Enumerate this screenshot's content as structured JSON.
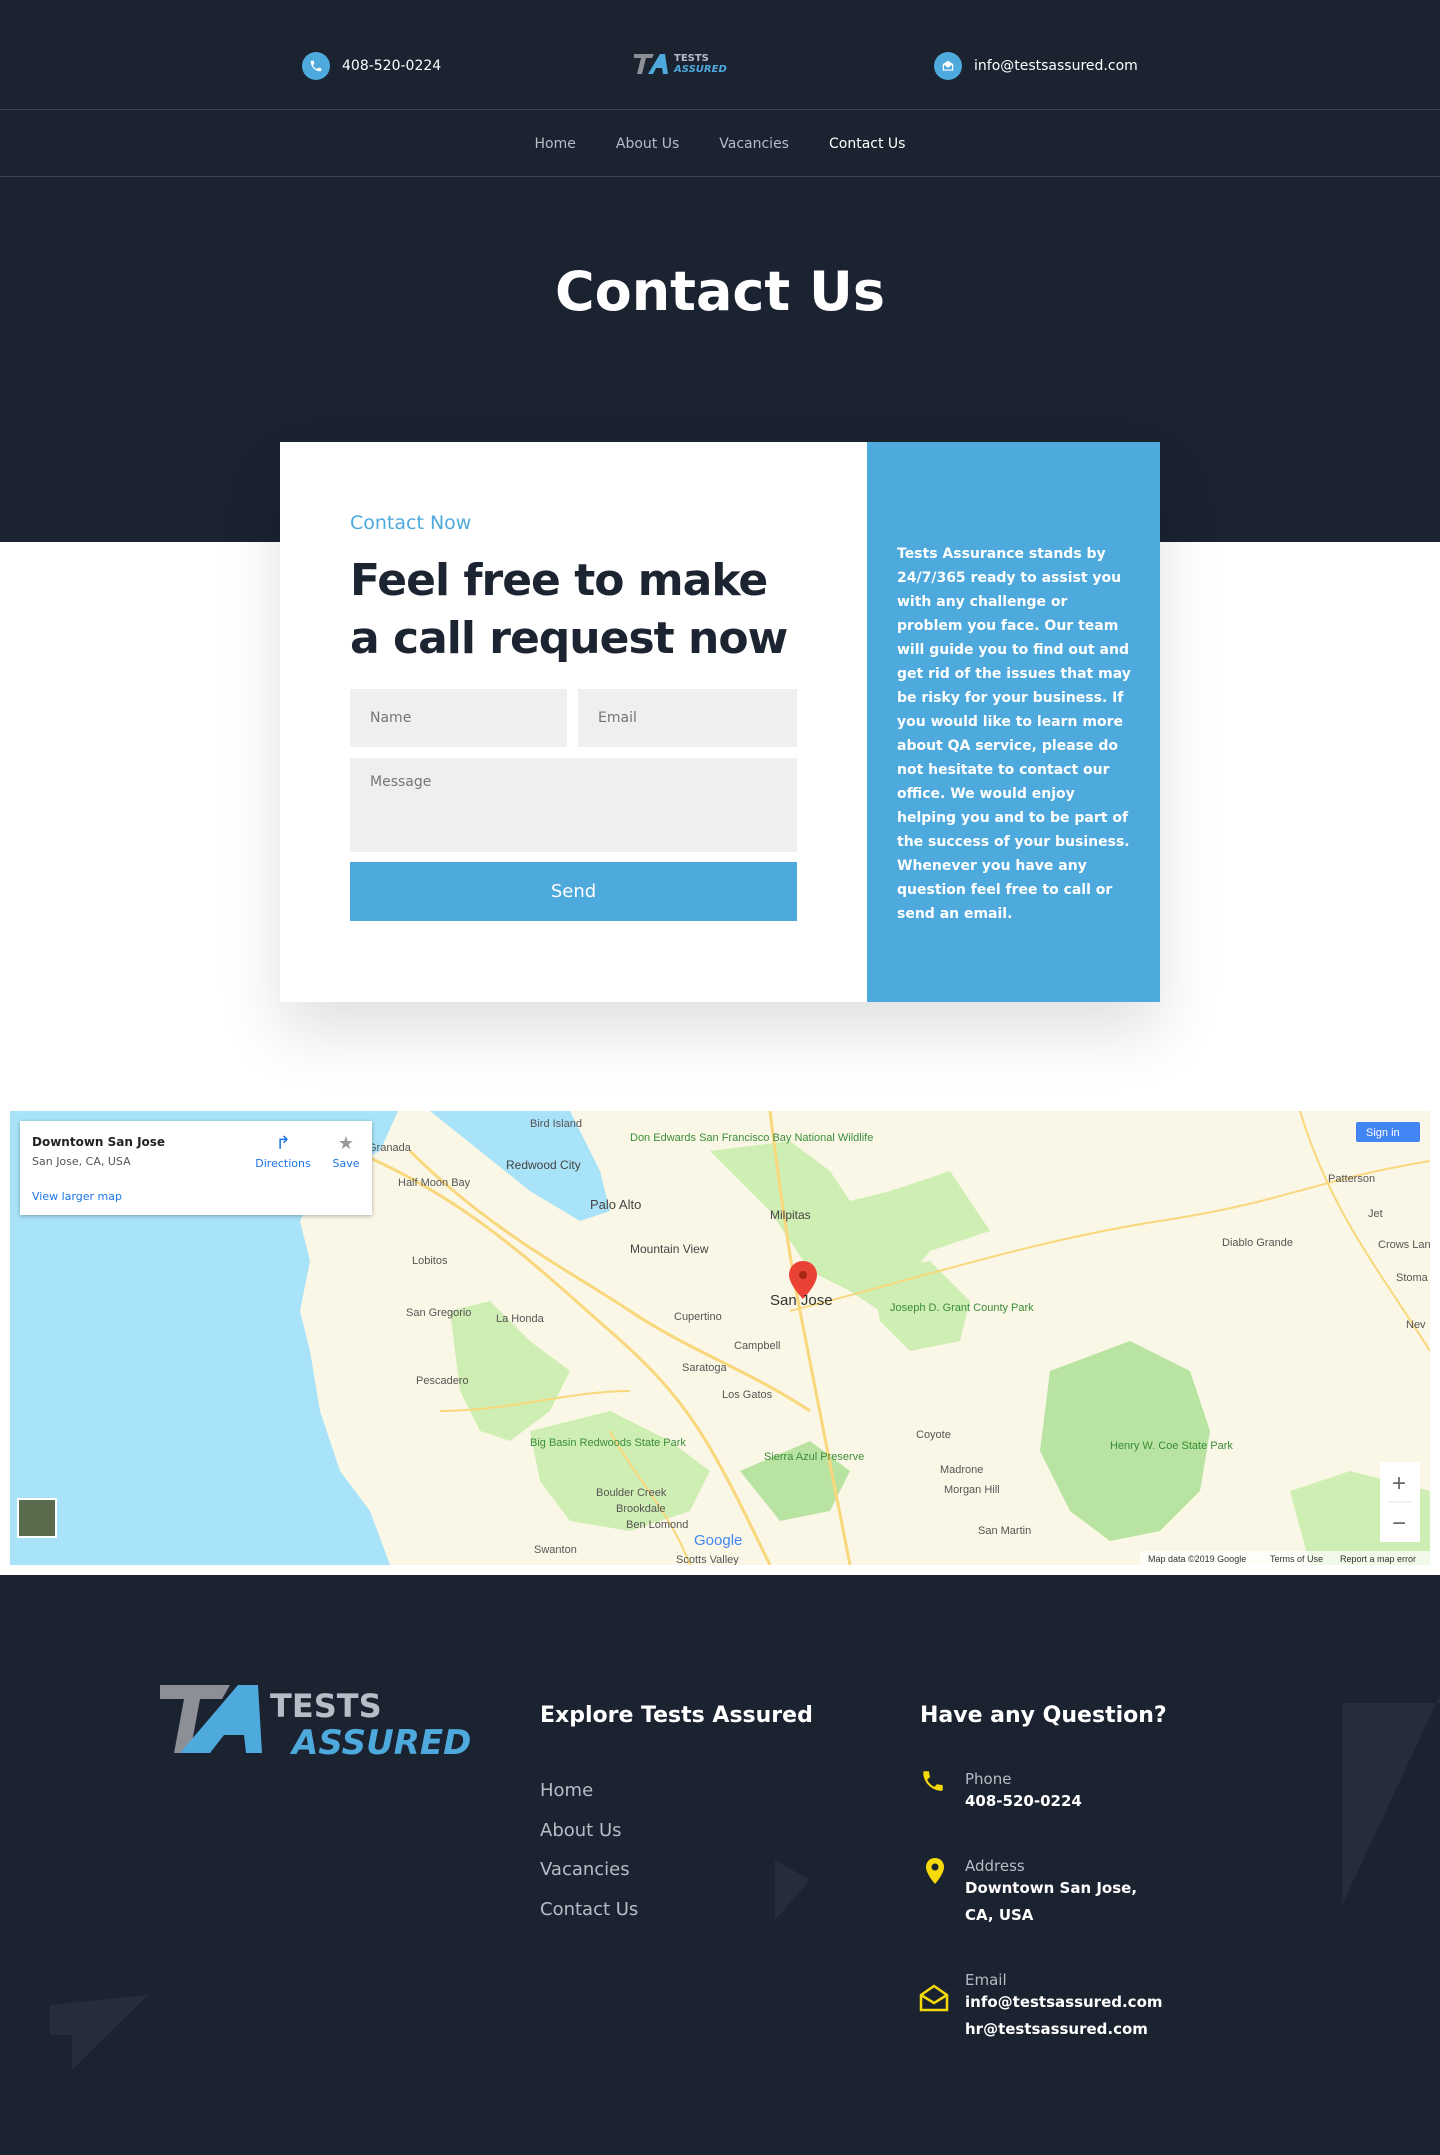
{
  "header": {
    "phone": "408-520-0224",
    "email": "info@testsassured.com",
    "logo_top": "TESTS",
    "logo_bottom": "ASSURED",
    "logo_mark": "TA"
  },
  "nav": {
    "items": [
      "Home",
      "About Us",
      "Vacancies",
      "Contact Us"
    ],
    "active": "Contact Us"
  },
  "page": {
    "title": "Contact Us"
  },
  "contact_card": {
    "kicker": "Contact Now",
    "heading": "Feel free to make a call request now",
    "name_placeholder": "Name",
    "email_placeholder": "Email",
    "message_placeholder": "Message",
    "send_label": "Send",
    "side_text": "Tests Assurance stands by 24/7/365 ready to assist you with any challenge or problem you face. Our team will guide you to find out and get rid of the issues that may be risky for your business. If you would like to learn more about QA service, please do not hesitate to contact our office. We would enjoy helping you and to be part of the success of your business. Whenever you have any question feel free to call or send an email."
  },
  "map": {
    "place_title": "Downtown San Jose",
    "place_address": "San Jose, CA, USA",
    "directions_label": "Directions",
    "save_label": "Save",
    "larger_map_label": "View larger map",
    "sign_in_label": "Sign in",
    "zoom_in": "+",
    "zoom_out": "−",
    "attribution": "Map data ©2019 Google",
    "terms": "Terms of Use",
    "report": "Report a map error",
    "google": "Google",
    "labels": {
      "sanjose": "San Jose",
      "paloalto": "Palo Alto",
      "milpitas": "Milpitas",
      "mountainview": "Mountain View",
      "cupertino": "Cupertino",
      "campbell": "Campbell",
      "saratoga": "Saratoga",
      "losgatos": "Los Gatos",
      "redwoodcity": "Redwood City",
      "halfmoon": "Half Moon Bay",
      "lahonda": "La Honda",
      "pescadero": "Pescadero",
      "sangregorio": "San Gregorio",
      "lobitos": "Lobitos",
      "birdisland": "Bird Island",
      "doned": "Don Edwards San Francisco Bay National Wildlife",
      "josephgrant": "Joseph D. Grant County Park",
      "henrycoe": "Henry W. Coe State Park",
      "coyote": "Coyote",
      "madrone": "Madrone",
      "morganhill": "Morgan Hill",
      "sanmartin": "San Martin",
      "diablogrande": "Diablo Grande",
      "patterson": "Patterson",
      "jet": "Jet",
      "crows": "Crows Landing",
      "sierraazul": "Sierra Azul Preserve",
      "bigbasin": "Big Basin Redwoods State Park",
      "bouldercreek": "Boulder Creek",
      "brookdale": "Brookdale",
      "benlomond": "Ben Lomond",
      "swanton": "Swanton",
      "scotts": "Scotts Valley",
      "granada": "Granada",
      "stoma": "Stoma",
      "nev": "Nev"
    }
  },
  "footer": {
    "logo_top": "TESTS",
    "logo_bottom": "ASSURED",
    "logo_mark": "TA",
    "explore_title": "Explore Tests Assured",
    "links": [
      "Home",
      "About Us",
      "Vacancies",
      "Contact Us"
    ],
    "question_title": "Have any Question?",
    "phone_label": "Phone",
    "phone_value": "408-520-0224",
    "address_label": "Address",
    "address_line1": "Downtown San Jose,",
    "address_line2": "CA, USA",
    "email_label": "Email",
    "email_value1": "info@testsassured.com",
    "email_value2": "hr@testsassured.com",
    "accent_color": "#f5d90a"
  },
  "colors": {
    "primary": "#4ea9dc",
    "dark": "#1b2230"
  }
}
